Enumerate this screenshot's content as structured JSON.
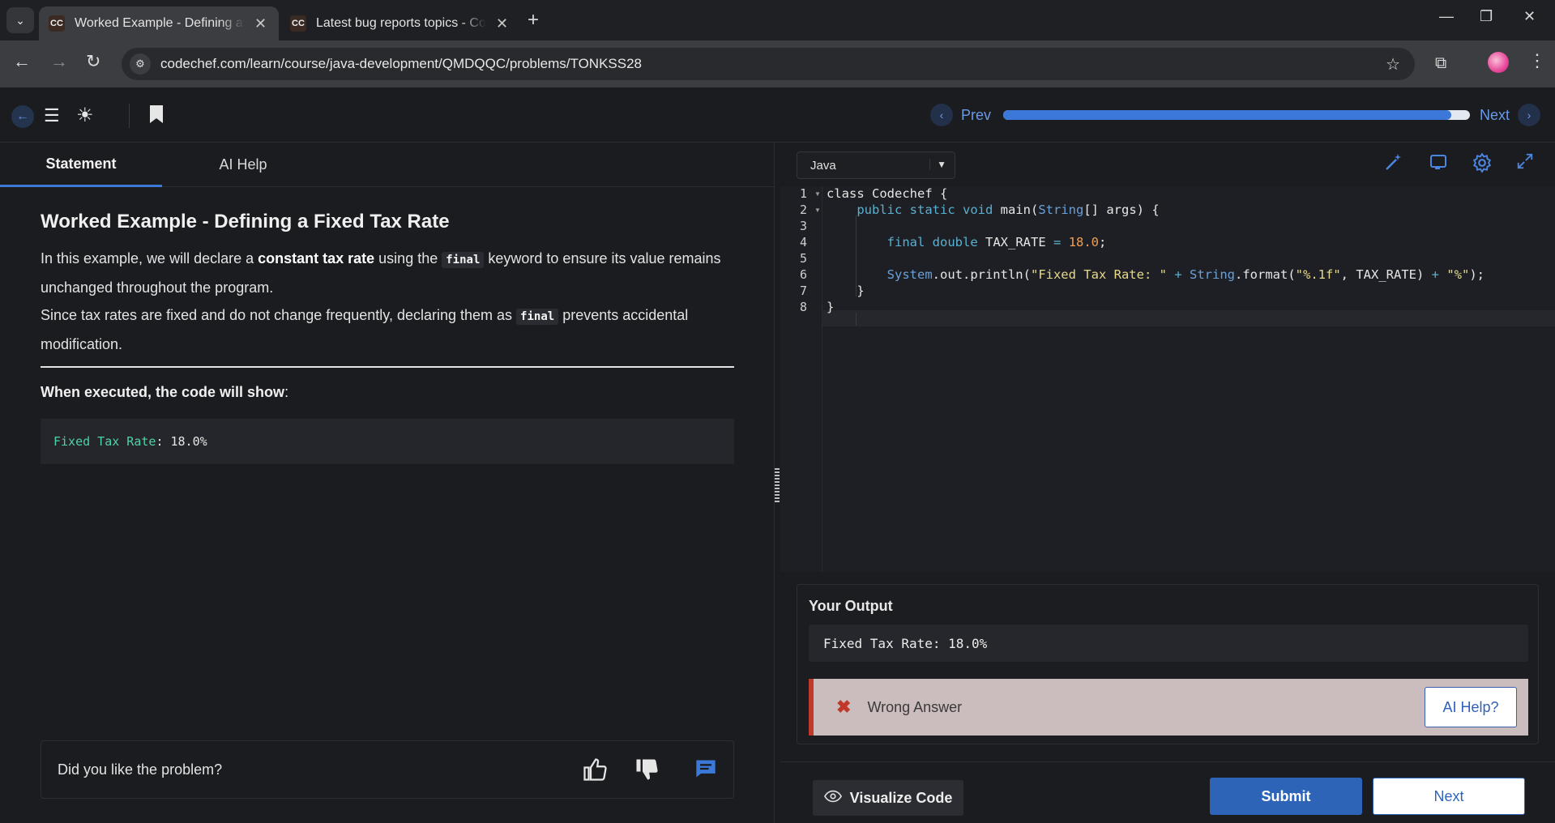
{
  "browser": {
    "tabs": [
      {
        "favicon": "CC",
        "title": "Worked Example - Defining a Fixed Tax Rate",
        "active": true
      },
      {
        "favicon": "CC",
        "title": "Latest bug reports topics - CodeChef",
        "active": false
      }
    ],
    "url": "codechef.com/learn/course/java-development/QMDQQC/problems/TONKSS28"
  },
  "header": {
    "prev_label": "Prev",
    "next_label": "Next",
    "progress": 0.96
  },
  "left": {
    "tabs": [
      {
        "label": "Statement",
        "active": true
      },
      {
        "label": "AI Help",
        "active": false
      }
    ],
    "title": "Worked Example - Defining a Fixed Tax Rate",
    "para1": {
      "t1": "In this example, we will declare a ",
      "bold": "constant tax rate",
      "t2": " using the ",
      "kw": "final",
      "t3": " keyword to ensure its value remains unchanged throughout the program."
    },
    "para2": {
      "t1": "Since tax rates are fixed and do not change frequently, declaring them as ",
      "kw": "final",
      "t2": " prevents accidental modification."
    },
    "exec_label_bold": "When executed, the code will show",
    "exec_label_colon": ":",
    "expected_output": {
      "part1": "Fixed Tax Rate",
      "part2": ": 18.0%"
    },
    "feedback_question": "Did you like the problem?"
  },
  "editor": {
    "language": "Java",
    "line_numbers": [
      "1",
      "2",
      "3",
      "4",
      "5",
      "6",
      "7",
      "8"
    ],
    "lines": [
      "class Codechef {",
      "    public static void main(String[] args) {",
      "",
      "        final double TAX_RATE = 18.0;",
      "",
      "        System.out.println(\"Fixed Tax Rate: \" + String.format(\"%.1f\", TAX_RATE) + \"%\");",
      "    }",
      "}"
    ]
  },
  "output": {
    "title": "Your Output",
    "value": "Fixed Tax Rate: 18.0%",
    "verdict": "Wrong Answer",
    "ai_help_label": "AI Help?"
  },
  "actions": {
    "visualize_label": "Visualize Code",
    "submit_label": "Submit",
    "next_label": "Next"
  },
  "colors": {
    "accent": "#3b78d8",
    "error": "#c0392b",
    "verdict_bg": "#cbbdbd"
  }
}
